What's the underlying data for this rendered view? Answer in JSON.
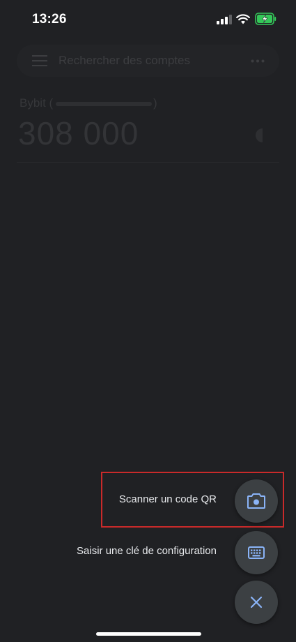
{
  "status_bar": {
    "time": "13:26",
    "icons": [
      "signal-icon",
      "wifi-icon",
      "battery-charging-icon"
    ]
  },
  "search": {
    "placeholder": "Rechercher des comptes"
  },
  "account": {
    "issuer": "Bybit (",
    "closing": ")",
    "code": "308 000"
  },
  "speed_dial": {
    "scan_label": "Scanner un code QR",
    "scan_icon": "camera-icon",
    "enter_key_label": "Saisir une clé de configuration",
    "enter_key_icon": "keyboard-icon",
    "close_icon": "close-icon"
  },
  "colors": {
    "background": "#202124",
    "fab": "#3c4043",
    "accent": "#8ab4f8",
    "highlight": "#c92a2a",
    "battery": "#34c759"
  }
}
